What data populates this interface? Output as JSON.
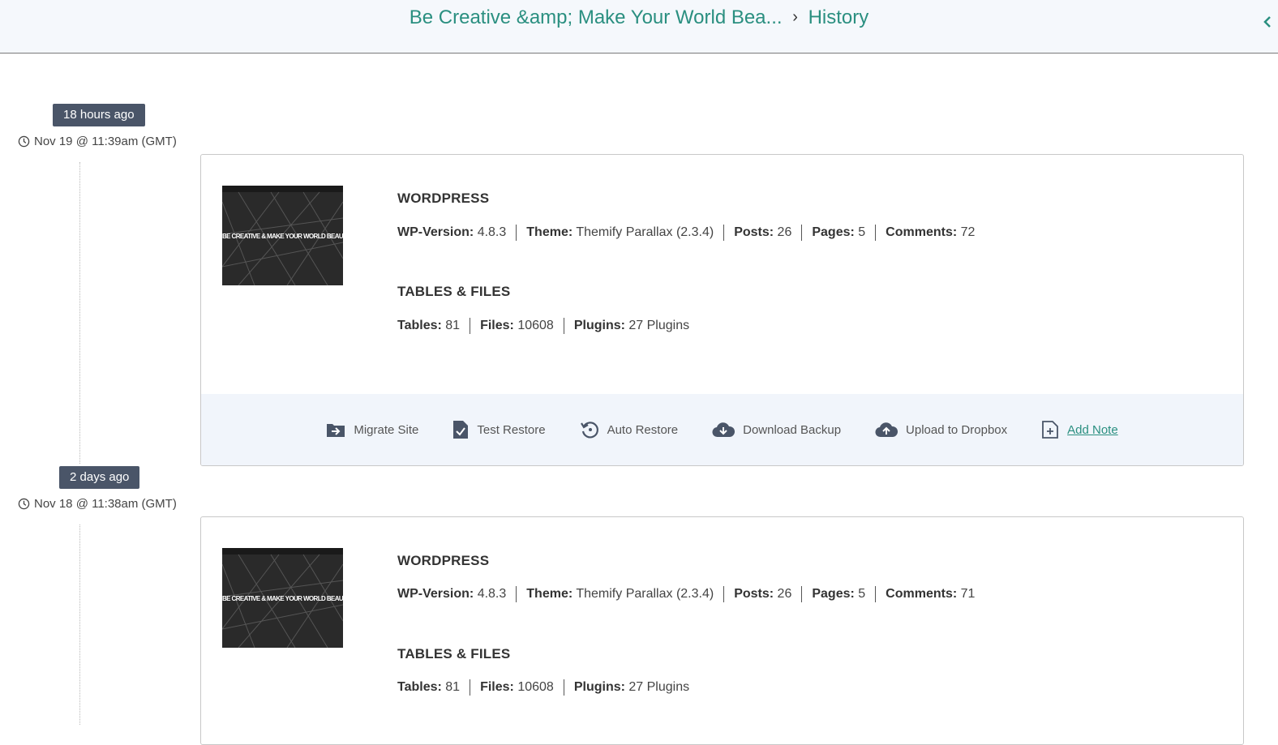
{
  "header": {
    "site_title": "Be Creative &amp; Make Your World Bea...",
    "separator": "›",
    "current": "History"
  },
  "backups": [
    {
      "relative_time": "18 hours ago",
      "datetime": "Nov 19 @ 11:39am (GMT)",
      "thumbnail_text": "BE CREATIVE & MAKE YOUR WORLD BEAUTIFUL",
      "wordpress_title": "WORDPRESS",
      "wp_version_label": "WP-Version:",
      "wp_version": "4.8.3",
      "theme_label": "Theme:",
      "theme": "Themify Parallax (2.3.4)",
      "posts_label": "Posts:",
      "posts": "26",
      "pages_label": "Pages:",
      "pages": "5",
      "comments_label": "Comments:",
      "comments": "72",
      "tables_title": "TABLES & FILES",
      "tables_label": "Tables:",
      "tables": "81",
      "files_label": "Files:",
      "files": "10608",
      "plugins_label": "Plugins:",
      "plugins": "27 Plugins"
    },
    {
      "relative_time": "2 days ago",
      "datetime": "Nov 18 @ 11:38am (GMT)",
      "thumbnail_text": "BE CREATIVE & MAKE YOUR WORLD BEAUTIFUL",
      "wordpress_title": "WORDPRESS",
      "wp_version_label": "WP-Version:",
      "wp_version": "4.8.3",
      "theme_label": "Theme:",
      "theme": "Themify Parallax (2.3.4)",
      "posts_label": "Posts:",
      "posts": "26",
      "pages_label": "Pages:",
      "pages": "5",
      "comments_label": "Comments:",
      "comments": "71",
      "tables_title": "TABLES & FILES",
      "tables_label": "Tables:",
      "tables": "81",
      "files_label": "Files:",
      "files": "10608",
      "plugins_label": "Plugins:",
      "plugins": "27 Plugins"
    }
  ],
  "actions": {
    "migrate": "Migrate Site",
    "test_restore": "Test Restore",
    "auto_restore": "Auto Restore",
    "download": "Download Backup",
    "upload": "Upload to Dropbox",
    "add_note": "Add Note"
  },
  "colors": {
    "accent": "#2a8f80",
    "badge_bg": "#4a5568",
    "icon": "#4a5568",
    "header_bg": "#f5f8fc",
    "actions_bg": "#f1f5fb"
  },
  "icons": {
    "collapse": "chevron-left-icon",
    "clock": "clock-icon",
    "migrate": "migrate-arrow-icon",
    "test_restore": "document-check-icon",
    "auto_restore": "restore-icon",
    "download": "cloud-download-icon",
    "upload": "cloud-upload-icon",
    "add_note": "note-add-icon"
  }
}
